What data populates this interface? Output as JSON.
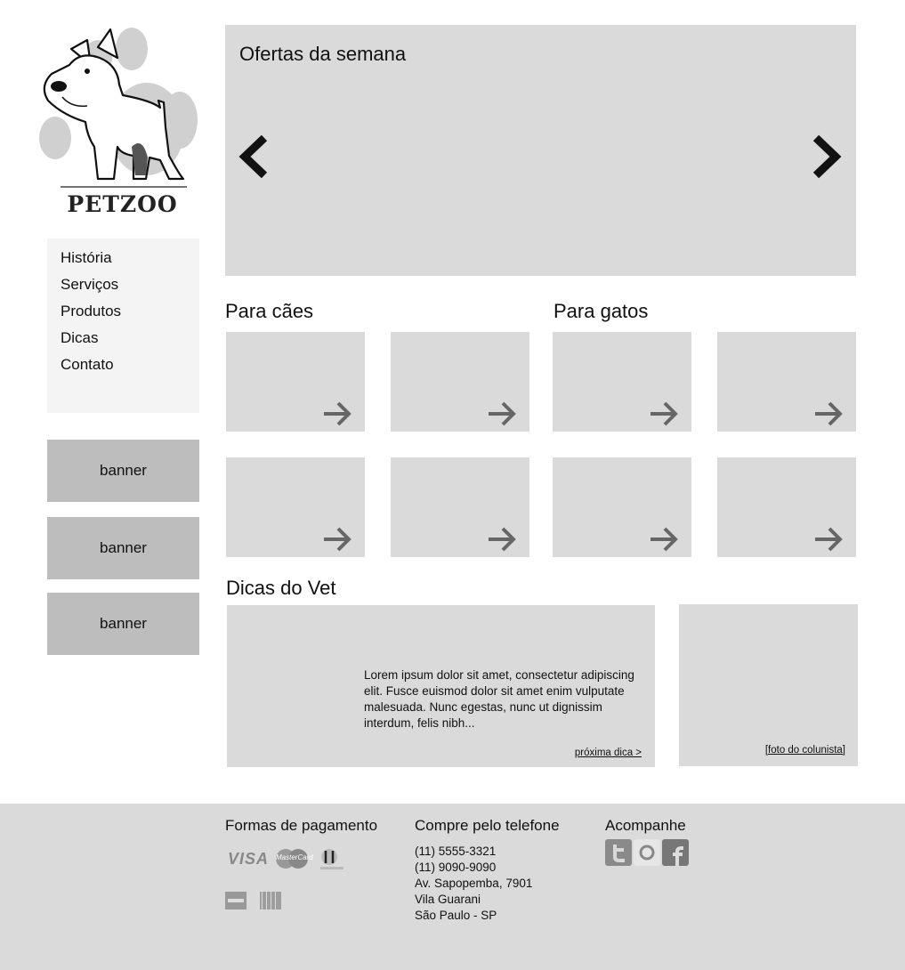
{
  "brand": {
    "logo_text": "PETZOO"
  },
  "nav": {
    "items": [
      "História",
      "Serviços",
      "Produtos",
      "Dicas",
      "Contato"
    ]
  },
  "banners": [
    "banner",
    "banner",
    "banner"
  ],
  "carousel": {
    "title": "Ofertas da semana"
  },
  "sections": {
    "dogs_title": "Para cães",
    "cats_title": "Para gatos",
    "tips_title": "Dicas do Vet"
  },
  "tip": {
    "text": "Lorem ipsum dolor sit amet, consectetur adipiscing elit. Fusce euismod dolor sit amet enim vulputate malesuada. Nunc egestas, nunc ut dignissim interdum, felis nibh...",
    "next_label": "próxima dica >",
    "photo_label": "[foto do colunista]"
  },
  "footer": {
    "payment_title": "Formas de pagamento",
    "payment_methods": [
      "VISA",
      "MasterCard",
      "Diners",
      "American Express",
      "Boleto"
    ],
    "visa_text": "VISA",
    "mastercard_text": "MasterCard",
    "phone_title": "Compre pelo telefone",
    "phone_lines": [
      "(11) 5555-3321",
      "(11) 9090-9090",
      "Av. Sapopemba, 7901",
      "Vila Guarani",
      "São Paulo - SP"
    ],
    "follow_title": "Acompanhe",
    "social": [
      "twitter-icon",
      "orkut-icon",
      "facebook-icon"
    ]
  },
  "colors": {
    "panel": "#dadada",
    "banner": "#bdbdbd",
    "nav_bg": "#f4f4f4",
    "footer": "#dadada"
  }
}
